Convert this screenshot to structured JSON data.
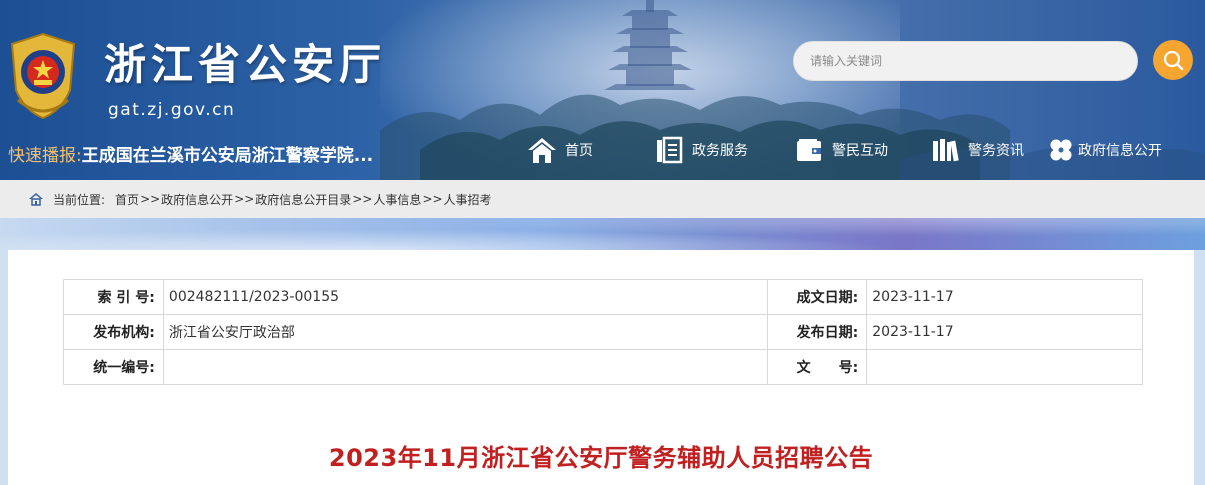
{
  "header": {
    "site_title": "浙江省公安厅",
    "site_domain": "gat.zj.gov.cn",
    "search_placeholder": "请输入关键词",
    "ticker_label": "快速播报:",
    "ticker_text": "王成国在兰溪市公安局浙江警察学院..."
  },
  "nav": [
    {
      "label": "首页",
      "icon": "house-icon"
    },
    {
      "label": "政务服务",
      "icon": "document-icon"
    },
    {
      "label": "警民互动",
      "icon": "wallet-icon"
    },
    {
      "label": "警务资讯",
      "icon": "books-icon"
    },
    {
      "label": "政府信息公开",
      "icon": "clover-icon"
    }
  ],
  "breadcrumb": {
    "prefix": "当前位置:",
    "items": [
      "首页",
      "政府信息公开",
      "政府信息公开目录",
      "人事信息",
      "人事招考"
    ],
    "separator": ">>"
  },
  "meta": {
    "index_label": "索 引 号:",
    "index_value": "002482111/2023-00155",
    "written_date_label": "成文日期:",
    "written_date_value": "2023-11-17",
    "publisher_label": "发布机构:",
    "publisher_value": "浙江省公安厅政治部",
    "publish_date_label": "发布日期:",
    "publish_date_value": "2023-11-17",
    "serial_label": "统一编号:",
    "serial_value": "",
    "doc_no_label": "文　　号:",
    "doc_no_value": ""
  },
  "article": {
    "title": "2023年11月浙江省公安厅警务辅助人员招聘公告"
  },
  "colors": {
    "accent_orange": "#f5a530",
    "title_red": "#c02020",
    "header_blue": "#2d62a6"
  }
}
